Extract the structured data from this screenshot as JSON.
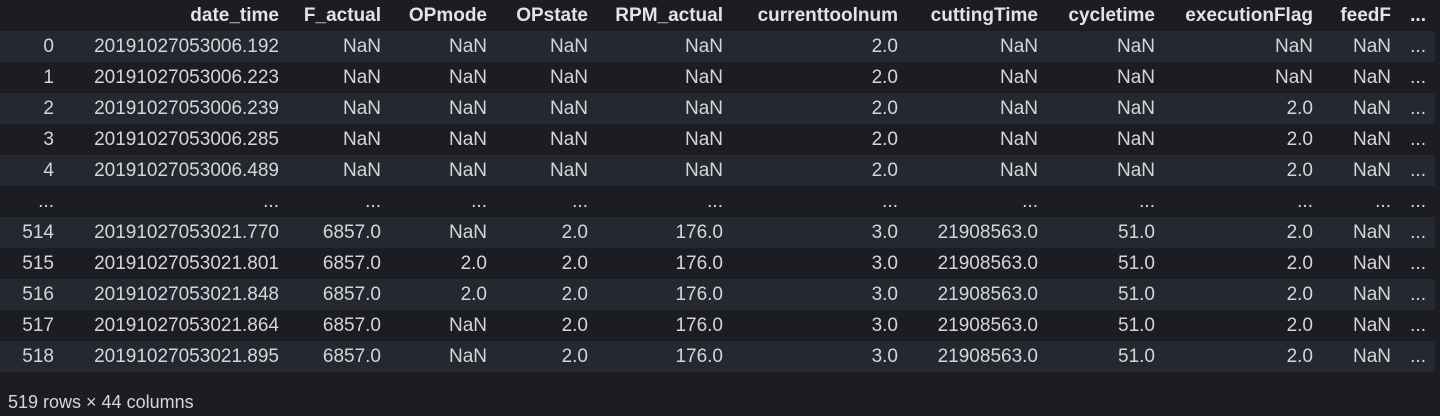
{
  "table": {
    "columns": [
      "",
      "date_time",
      "F_actual",
      "OPmode",
      "OPstate",
      "RPM_actual",
      "currenttoolnum",
      "cuttingTime",
      "cycletime",
      "executionFlag",
      "feedF",
      "..."
    ],
    "rows": [
      [
        "0",
        "20191027053006.192",
        "NaN",
        "NaN",
        "NaN",
        "NaN",
        "2.0",
        "NaN",
        "NaN",
        "NaN",
        "NaN",
        "..."
      ],
      [
        "1",
        "20191027053006.223",
        "NaN",
        "NaN",
        "NaN",
        "NaN",
        "2.0",
        "NaN",
        "NaN",
        "NaN",
        "NaN",
        "..."
      ],
      [
        "2",
        "20191027053006.239",
        "NaN",
        "NaN",
        "NaN",
        "NaN",
        "2.0",
        "NaN",
        "NaN",
        "2.0",
        "NaN",
        "..."
      ],
      [
        "3",
        "20191027053006.285",
        "NaN",
        "NaN",
        "NaN",
        "NaN",
        "2.0",
        "NaN",
        "NaN",
        "2.0",
        "NaN",
        "..."
      ],
      [
        "4",
        "20191027053006.489",
        "NaN",
        "NaN",
        "NaN",
        "NaN",
        "2.0",
        "NaN",
        "NaN",
        "2.0",
        "NaN",
        "..."
      ],
      [
        "...",
        "...",
        "...",
        "...",
        "...",
        "...",
        "...",
        "...",
        "...",
        "...",
        "...",
        "..."
      ],
      [
        "514",
        "20191027053021.770",
        "6857.0",
        "NaN",
        "2.0",
        "176.0",
        "3.0",
        "21908563.0",
        "51.0",
        "2.0",
        "NaN",
        "..."
      ],
      [
        "515",
        "20191027053021.801",
        "6857.0",
        "2.0",
        "2.0",
        "176.0",
        "3.0",
        "21908563.0",
        "51.0",
        "2.0",
        "NaN",
        "..."
      ],
      [
        "516",
        "20191027053021.848",
        "6857.0",
        "2.0",
        "2.0",
        "176.0",
        "3.0",
        "21908563.0",
        "51.0",
        "2.0",
        "NaN",
        "..."
      ],
      [
        "517",
        "20191027053021.864",
        "6857.0",
        "NaN",
        "2.0",
        "176.0",
        "3.0",
        "21908563.0",
        "51.0",
        "2.0",
        "NaN",
        "..."
      ],
      [
        "518",
        "20191027053021.895",
        "6857.0",
        "NaN",
        "2.0",
        "176.0",
        "3.0",
        "21908563.0",
        "51.0",
        "2.0",
        "NaN",
        "..."
      ]
    ]
  },
  "summary": "519 rows × 44 columns"
}
